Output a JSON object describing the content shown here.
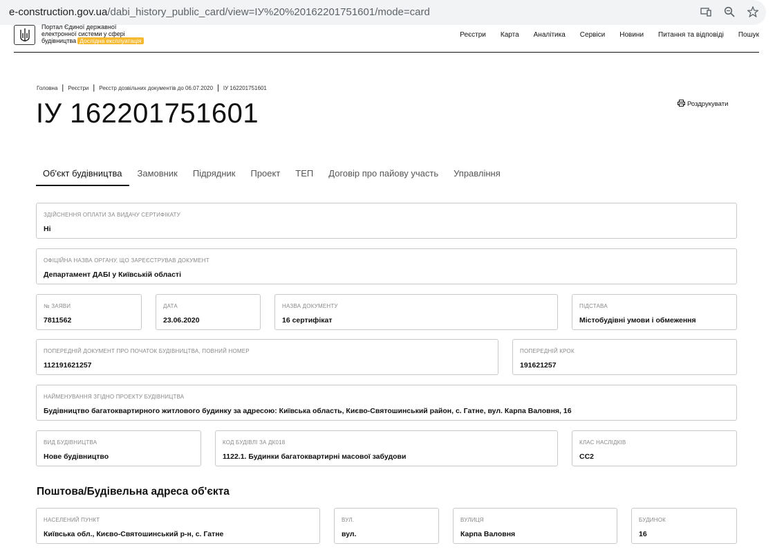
{
  "browser": {
    "url_host": "e-construction.gov.ua",
    "url_path": "/dabi_history_public_card/view=ІУ%20%20162201751601/mode=card"
  },
  "header": {
    "portal_line1": "Портал Єдиної державної",
    "portal_line2": "електронної системи у сфері",
    "portal_line3": "будівництва",
    "badge": "Дослідна експлуатація",
    "nav": [
      "Реєстри",
      "Карта",
      "Аналітика",
      "Сервіси",
      "Новини",
      "Питання та відповіді",
      "Пошук"
    ]
  },
  "breadcrumb": [
    "Головна",
    "Реєстри",
    "Реєстр дозвільних документів до 06.07.2020",
    "ІУ 162201751601"
  ],
  "page": {
    "title": "ІУ 162201751601",
    "print_label": "Роздрукувати"
  },
  "tabs": [
    "Об'єкт будівництва",
    "Замовник",
    "Підрядник",
    "Проект",
    "ТЕП",
    "Договір про пайову участь",
    "Управління"
  ],
  "fields": {
    "payment": {
      "label": "Здійснення оплати за видачу сертифікату",
      "value": "Ні"
    },
    "authority": {
      "label": "Офіційна назва органу, що зареєстрував документ",
      "value": "Департамент ДАБІ у Київській області"
    },
    "app_no": {
      "label": "№ заяви",
      "value": "7811562"
    },
    "date": {
      "label": "Дата",
      "value": "23.06.2020"
    },
    "doc_name": {
      "label": "Назва документу",
      "value": "16 сертифікат"
    },
    "basis": {
      "label": "Підстава",
      "value": "Містобудівні умови і обмеження"
    },
    "prev_doc": {
      "label": "Попередній документ про початок будівництва, повний номер",
      "value": "112191621257"
    },
    "prev_step": {
      "label": "Попередній крок",
      "value": "191621257"
    },
    "project_name": {
      "label": "Найменування згідно проекту будівництва",
      "value": "Будівництво багатоквартирного житлового будинку за адресою: Київська область, Києво-Святошинський район, с. Гатне, вул. Карпа Валовня, 16"
    },
    "build_type": {
      "label": "Вид будівництва",
      "value": "Нове будівництво"
    },
    "code": {
      "label": "Код будівлі за ДК018",
      "value": "1122.1. Будинки багатоквартирні масової забудови"
    },
    "class": {
      "label": "Клас наслідків",
      "value": "СС2"
    }
  },
  "address": {
    "title": "Поштова/Будівельна адреса об'єкта",
    "locality": {
      "label": "Населений пункт",
      "value": "Київська обл., Києво-Святошинський р-н, с. Гатне"
    },
    "street_type": {
      "label": "Вул.",
      "value": "вул."
    },
    "street": {
      "label": "Вулиця",
      "value": "Карпа Валовня"
    },
    "building": {
      "label": "Будинок",
      "value": "16"
    }
  }
}
